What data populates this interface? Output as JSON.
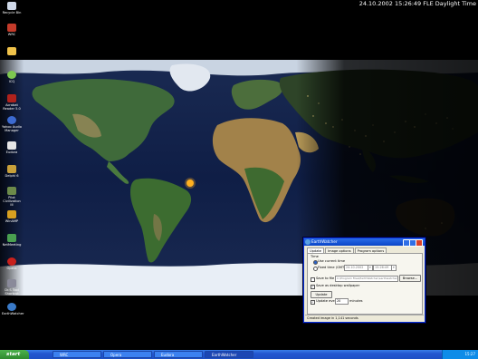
{
  "clock_overlay": "24.10.2002 15:26:49 FLE Daylight Time",
  "desktop_icons": [
    {
      "label": "Recycle Bin",
      "icon": "recycle-bin-icon"
    },
    {
      "label": "WRC",
      "icon": "wrc-icon"
    },
    {
      "label": "",
      "icon": "folder-icon"
    },
    {
      "label": "ICQ",
      "icon": "icq-icon"
    },
    {
      "label": "Acrobat Reader 5.0",
      "icon": "acrobat-icon"
    },
    {
      "label": "Yahoo Audio Manager",
      "icon": "audio-manager-icon"
    },
    {
      "label": "Eudora",
      "icon": "eudora-icon"
    },
    {
      "label": "Delphi 6",
      "icon": "delphi-icon"
    },
    {
      "label": "Pilot Civilization III",
      "icon": "civilization-icon"
    },
    {
      "label": "WinAMP",
      "icon": "winamp-icon"
    },
    {
      "label": "NetMeeting",
      "icon": "netmeeting-icon"
    },
    {
      "label": "Opera",
      "icon": "opera-icon"
    },
    {
      "label": "Dr.S Tool Shortcut",
      "icon": "tool-icon"
    },
    {
      "label": "EarthWatcher",
      "icon": "earthwatcher-icon"
    }
  ],
  "window": {
    "title": "EarthWatcher",
    "tabs": [
      "Update",
      "Image options",
      "Program options"
    ],
    "time_group": "Time",
    "use_current_time": "Use current time",
    "fixed_time": "Fixed time (GMT)",
    "fixed_date_value": "24.10.2002",
    "fixed_time_value": "15:26:49",
    "save_to_file": "Save to file",
    "save_path": "C:\\Program Files\\EarthWatcher\\earthwatcher.jpg",
    "browse": "Browse...",
    "save_wallpaper": "Save as desktop wallpaper",
    "update_button": "Update",
    "update_every": "Update every",
    "update_interval": "20",
    "minutes": "minutes",
    "status": "Created image in 1,141 seconds"
  },
  "taskbar": {
    "start": "start",
    "tasks": [
      "WRC",
      "Opera",
      "Eudora",
      "EarthWatcher"
    ],
    "clock": "15:27"
  },
  "colors": {
    "taskbar": "#245edb",
    "start": "#3c9a3c",
    "window_title": "#0a45c8",
    "sun": "#ffb020"
  }
}
